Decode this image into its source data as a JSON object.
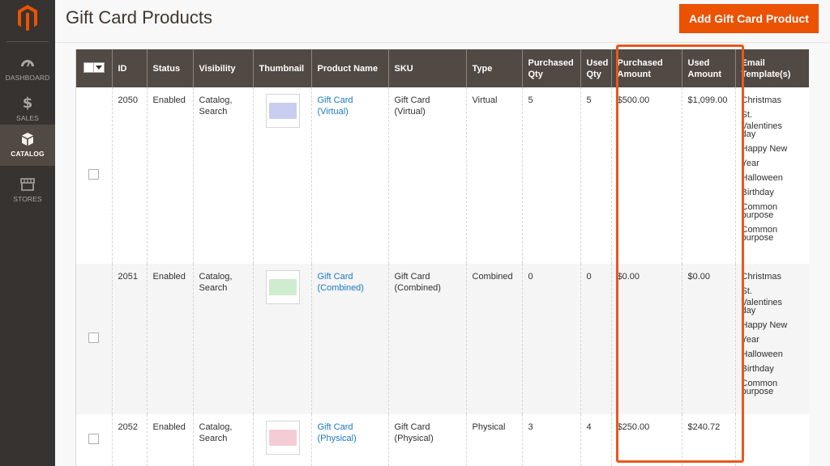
{
  "sidebar": {
    "items": [
      {
        "label": "DASHBOARD",
        "icon": "dashboard-icon"
      },
      {
        "label": "SALES",
        "icon": "dollar-icon"
      },
      {
        "label": "CATALOG",
        "icon": "catalog-box-icon",
        "active": true
      },
      {
        "label": "STORES",
        "icon": "store-icon"
      }
    ]
  },
  "header": {
    "title": "Gift Card Products",
    "add_button_label": "Add Gift Card Product"
  },
  "grid": {
    "columns": {
      "id": "ID",
      "status": "Status",
      "visibility": "Visibility",
      "thumbnail": "Thumbnail",
      "name": "Product Name",
      "sku": "SKU",
      "type": "Type",
      "purchased_qty_1": "Purchased",
      "purchased_qty_2": "Qty",
      "used_qty_1": "Used",
      "used_qty_2": "Qty",
      "purchased_amount_1": "Purchased",
      "purchased_amount_2": "Amount",
      "used_amount_1": "Used",
      "used_amount_2": "Amount",
      "email_1": "Email",
      "email_2": "Template(s)"
    },
    "rows": [
      {
        "id": "2050",
        "status": "Enabled",
        "visibility_1": "Catalog,",
        "visibility_2": "Search",
        "name_1": "Gift Card",
        "name_2": "(Virtual)",
        "sku_1": "Gift Card",
        "sku_2": "(Virtual)",
        "type": "Virtual",
        "purchased_qty": "5",
        "used_qty": "5",
        "purchased_amount": "$500.00",
        "used_amount": "$1,099.00",
        "thumb_color": "#c9cdf0",
        "templates": [
          "Christmas",
          "St.",
          "Valentines",
          "day",
          "Happy New",
          "Year",
          "Halloween",
          "Birthday",
          "Common",
          "purpose",
          "Common",
          "purpose"
        ]
      },
      {
        "id": "2051",
        "status": "Enabled",
        "visibility_1": "Catalog,",
        "visibility_2": "Search",
        "name_1": "Gift Card",
        "name_2": "(Combined)",
        "sku_1": "Gift Card",
        "sku_2": "(Combined)",
        "type": "Combined",
        "purchased_qty": "0",
        "used_qty": "0",
        "purchased_amount": "$0.00",
        "used_amount": "$0.00",
        "thumb_color": "#cfeccf",
        "templates": [
          "Christmas",
          "St.",
          "Valentines",
          "day",
          "Happy New",
          "Year",
          "Halloween",
          "Birthday",
          "Common",
          "purpose"
        ]
      },
      {
        "id": "2052",
        "status": "Enabled",
        "visibility_1": "Catalog,",
        "visibility_2": "Search",
        "name_1": "Gift Card",
        "name_2": "(Physical)",
        "sku_1": "Gift Card",
        "sku_2": "(Physical)",
        "type": "Physical",
        "purchased_qty": "3",
        "used_qty": "4",
        "purchased_amount": "$250.00",
        "used_amount": "$240.72",
        "thumb_color": "#f5ccd6",
        "templates": []
      }
    ]
  },
  "colors": {
    "accent": "#eb5202",
    "highlight": "#e8581f",
    "header_bg": "#514943",
    "sidebar_bg": "#373330",
    "link": "#1979c3"
  }
}
